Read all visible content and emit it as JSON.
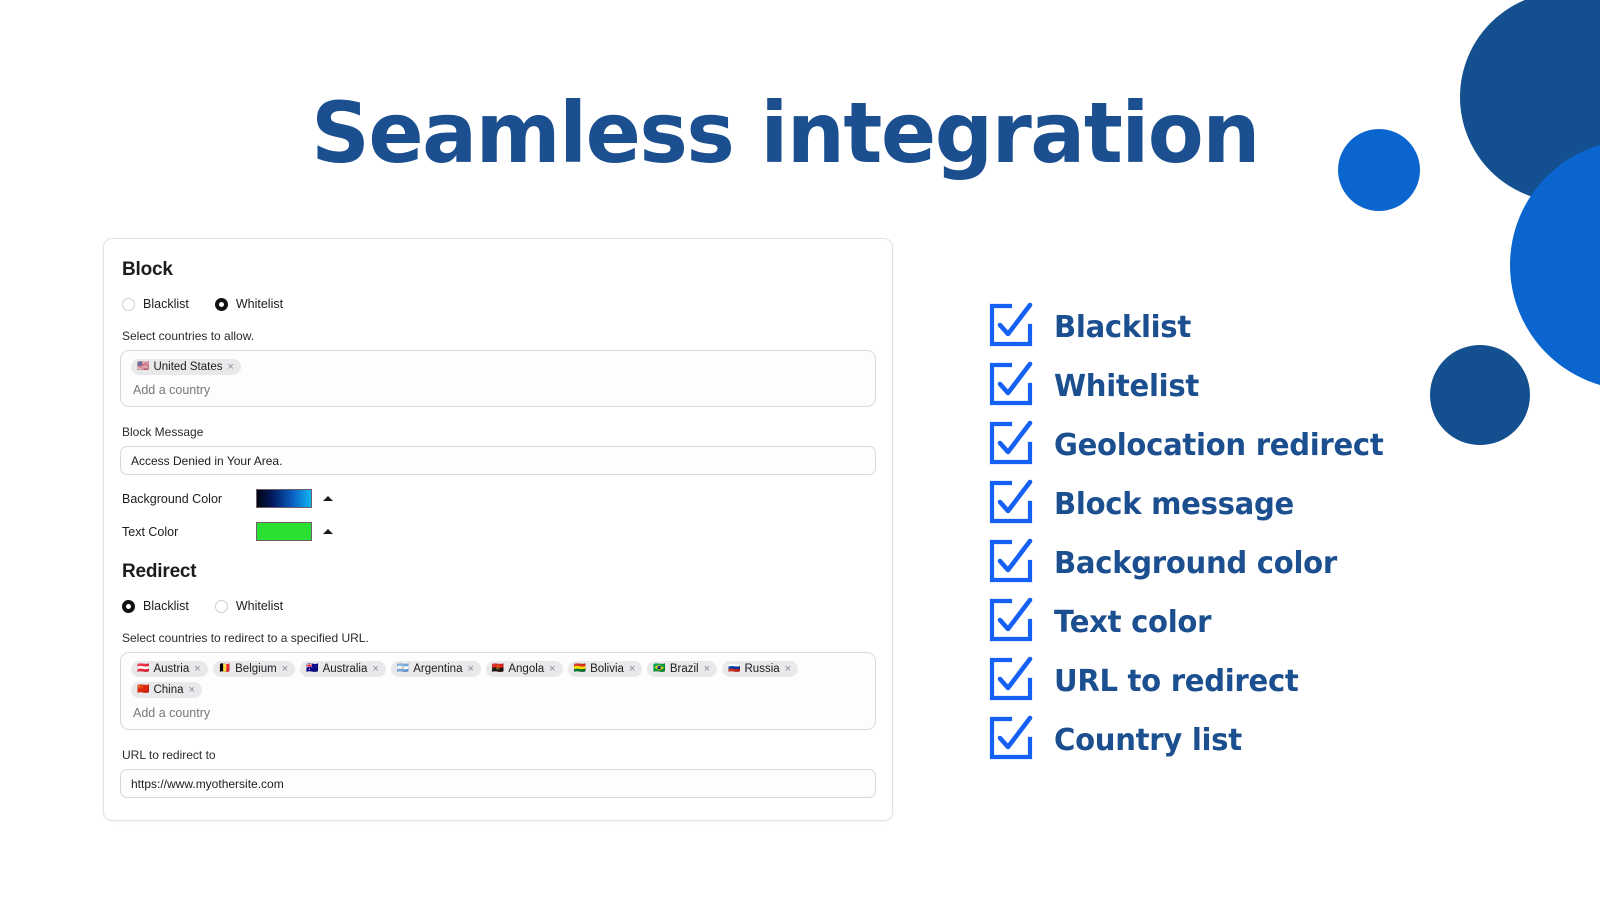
{
  "page": {
    "title": "Seamless integration",
    "accent_navy": "#1B4F8F",
    "accent_blue": "#0A66CE",
    "check_blue": "#1560F5"
  },
  "decor": {
    "circle_navy_top": "#14508F",
    "circle_blue_small": "#0A66CE",
    "circle_blue_big": "#0A66CE",
    "circle_navy_bottom": "#14508F"
  },
  "card": {
    "block": {
      "heading": "Block",
      "mode_options": [
        {
          "label": "Blacklist",
          "selected": false
        },
        {
          "label": "Whitelist",
          "selected": true
        }
      ],
      "countries_label": "Select countries to allow.",
      "countries": [
        {
          "name": "United States",
          "flag": "🇺🇸",
          "remove": "×"
        }
      ],
      "add_country_placeholder": "Add a country",
      "block_message_label": "Block Message",
      "block_message_value": "Access Denied in Your Area.",
      "background_color_label": "Background Color",
      "background_color_value": "linear-gradient(90deg,#000611 0%,#01185c 28%,#0a5fc2 66%,#10b4f0 100%)",
      "text_color_label": "Text Color",
      "text_color_value": "#2ae030"
    },
    "redirect": {
      "heading": "Redirect",
      "mode_options": [
        {
          "label": "Blacklist",
          "selected": true
        },
        {
          "label": "Whitelist",
          "selected": false
        }
      ],
      "countries_label": "Select countries to redirect to a specified URL.",
      "countries": [
        {
          "name": "Austria",
          "flag": "🇦🇹",
          "remove": "×"
        },
        {
          "name": "Belgium",
          "flag": "🇧🇪",
          "remove": "×"
        },
        {
          "name": "Australia",
          "flag": "🇦🇺",
          "remove": "×"
        },
        {
          "name": "Argentina",
          "flag": "🇦🇷",
          "remove": "×"
        },
        {
          "name": "Angola",
          "flag": "🇦🇴",
          "remove": "×"
        },
        {
          "name": "Bolivia",
          "flag": "🇧🇴",
          "remove": "×"
        },
        {
          "name": "Brazil",
          "flag": "🇧🇷",
          "remove": "×"
        },
        {
          "name": "Russia",
          "flag": "🇷🇺",
          "remove": "×"
        },
        {
          "name": "China",
          "flag": "🇨🇳",
          "remove": "×"
        }
      ],
      "add_country_placeholder": "Add a country",
      "url_label": "URL to redirect to",
      "url_value": "https://www.myothersite.com"
    }
  },
  "features": [
    {
      "label": "Blacklist"
    },
    {
      "label": "Whitelist"
    },
    {
      "label": "Geolocation redirect"
    },
    {
      "label": "Block message"
    },
    {
      "label": "Background color"
    },
    {
      "label": "Text color"
    },
    {
      "label": "URL to redirect"
    },
    {
      "label": "Country list"
    }
  ]
}
